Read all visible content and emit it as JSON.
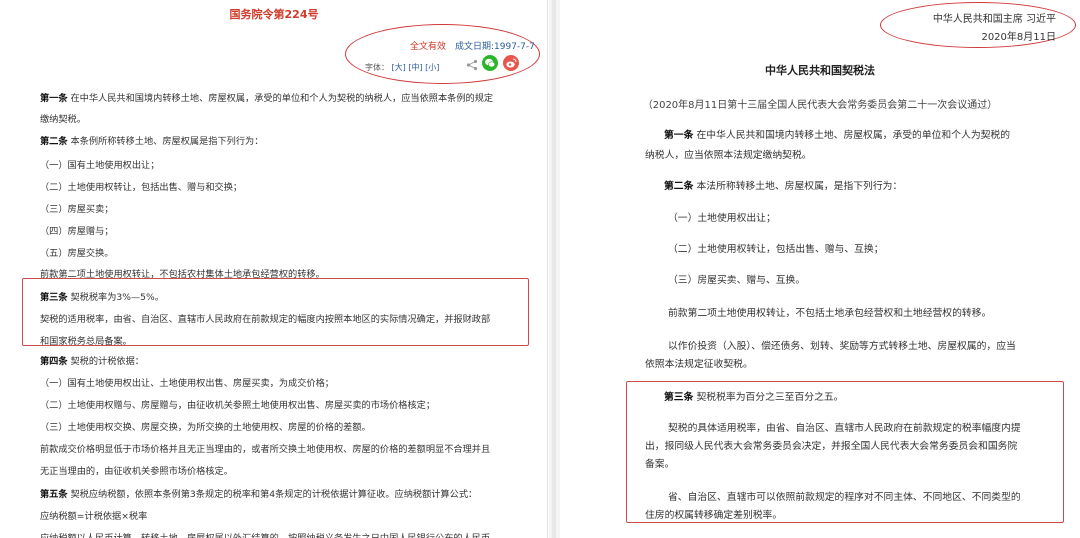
{
  "left": {
    "decree_title": "国务院令第224号",
    "status_valid": "全文有效",
    "date_text": "成文日期:1997-7-7",
    "fontsize_label": "字体：",
    "fontsize_large": "[大]",
    "fontsize_medium": "[中]",
    "fontsize_small": "[小]",
    "lines": [
      {
        "bold": "第一条",
        "text": " 在中华人民共和国境内转移土地、房屋权属，承受的单位和个人为契税的纳税人，应当依照本条例的规定"
      },
      {
        "bold": "",
        "text": "缴纳契税。"
      },
      {
        "bold": "第二条",
        "text": " 本条例所称转移土地、房屋权属是指下列行为："
      },
      {
        "bold": "",
        "text": "（一）国有土地使用权出让；"
      },
      {
        "bold": "",
        "text": "（二）土地使用权转让，包括出售、赠与和交换；"
      },
      {
        "bold": "",
        "text": "（三）房屋买卖；"
      },
      {
        "bold": "",
        "text": "（四）房屋赠与；"
      },
      {
        "bold": "",
        "text": "（五）房屋交换。"
      },
      {
        "bold": "",
        "text": "前款第二项土地使用权转让，不包括农村集体土地承包经营权的转移。"
      },
      {
        "bold": "第三条",
        "text": " 契税税率为3%—5%。"
      },
      {
        "bold": "",
        "text": "契税的适用税率，由省、自治区、直辖市人民政府在前款规定的幅度内按照本地区的实际情况确定，并报财政部"
      },
      {
        "bold": "",
        "text": "和国家税务总局备案。"
      },
      {
        "bold": "第四条",
        "text": " 契税的计税依据："
      },
      {
        "bold": "",
        "text": "（一）国有土地使用权出让、土地使用权出售、房屋买卖，为成交价格；"
      },
      {
        "bold": "",
        "text": "（二）土地使用权赠与、房屋赠与，由征收机关参照土地使用权出售、房屋买卖的市场价格核定；"
      },
      {
        "bold": "",
        "text": "（三）土地使用权交换、房屋交换，为所交换的土地使用权、房屋的价格的差额。"
      },
      {
        "bold": "",
        "text": "前款成交价格明显低于市场价格并且无正当理由的，或者所交换土地使用权、房屋的价格的差额明显不合理并且"
      },
      {
        "bold": "",
        "text": "无正当理由的，由征收机关参照市场价格核定。"
      },
      {
        "bold": "第五条",
        "text": " 契税应纳税额，依照本条例第3条规定的税率和第4条规定的计税依据计算征收。应纳税额计算公式："
      },
      {
        "bold": "",
        "text": "应纳税额=计税依据×税率"
      },
      {
        "bold": "",
        "text": "应纳税额以人民币计算。转移土地、房屋权属以外汇结算的，按照纳税义务发生之日中国人民银行公布的人民币"
      }
    ]
  },
  "right": {
    "signer_title": "中华人民共和国主席  习近平",
    "signer_date": "2020年8月11日",
    "law_title": "中华人民共和国契税法",
    "adoption": "（2020年8月11日第十三届全国人民代表大会常务委员会第二十一次会议通过）",
    "lines": [
      {
        "bold": "第一条",
        "text": "  在中华人民共和国境内转移土地、房屋权属，承受的单位和个人为契税的"
      },
      {
        "bold": "",
        "text": "纳税人，应当依照本法规定缴纳契税。"
      },
      {
        "bold": "第二条",
        "text": "  本法所称转移土地、房屋权属，是指下列行为："
      },
      {
        "bold": "",
        "text": "（一）土地使用权出让；"
      },
      {
        "bold": "",
        "text": "（二）土地使用权转让，包括出售、赠与、互换；"
      },
      {
        "bold": "",
        "text": "（三）房屋买卖、赠与、互换。"
      },
      {
        "bold": "",
        "text": "前款第二项土地使用权转让，不包括土地承包经营权和土地经营权的转移。"
      },
      {
        "bold": "",
        "text": "以作价投资（入股）、偿还债务、划转、奖励等方式转移土地、房屋权属的，应当"
      },
      {
        "bold": "",
        "text": "依照本法规定征收契税。"
      },
      {
        "bold": "第三条",
        "text": "  契税税率为百分之三至百分之五。"
      },
      {
        "bold": "",
        "text": "契税的具体适用税率，由省、自治区、直辖市人民政府在前款规定的税率幅度内提"
      },
      {
        "bold": "",
        "text": "出，报同级人民代表大会常务委员会决定，并报全国人民代表大会常务委员会和国务院"
      },
      {
        "bold": "",
        "text": "备案。"
      },
      {
        "bold": "",
        "text": "省、自治区、直辖市可以依照前款规定的程序对不同主体、不同地区、不同类型的"
      },
      {
        "bold": "",
        "text": "住房的权属转移确定差别税率。"
      }
    ]
  }
}
